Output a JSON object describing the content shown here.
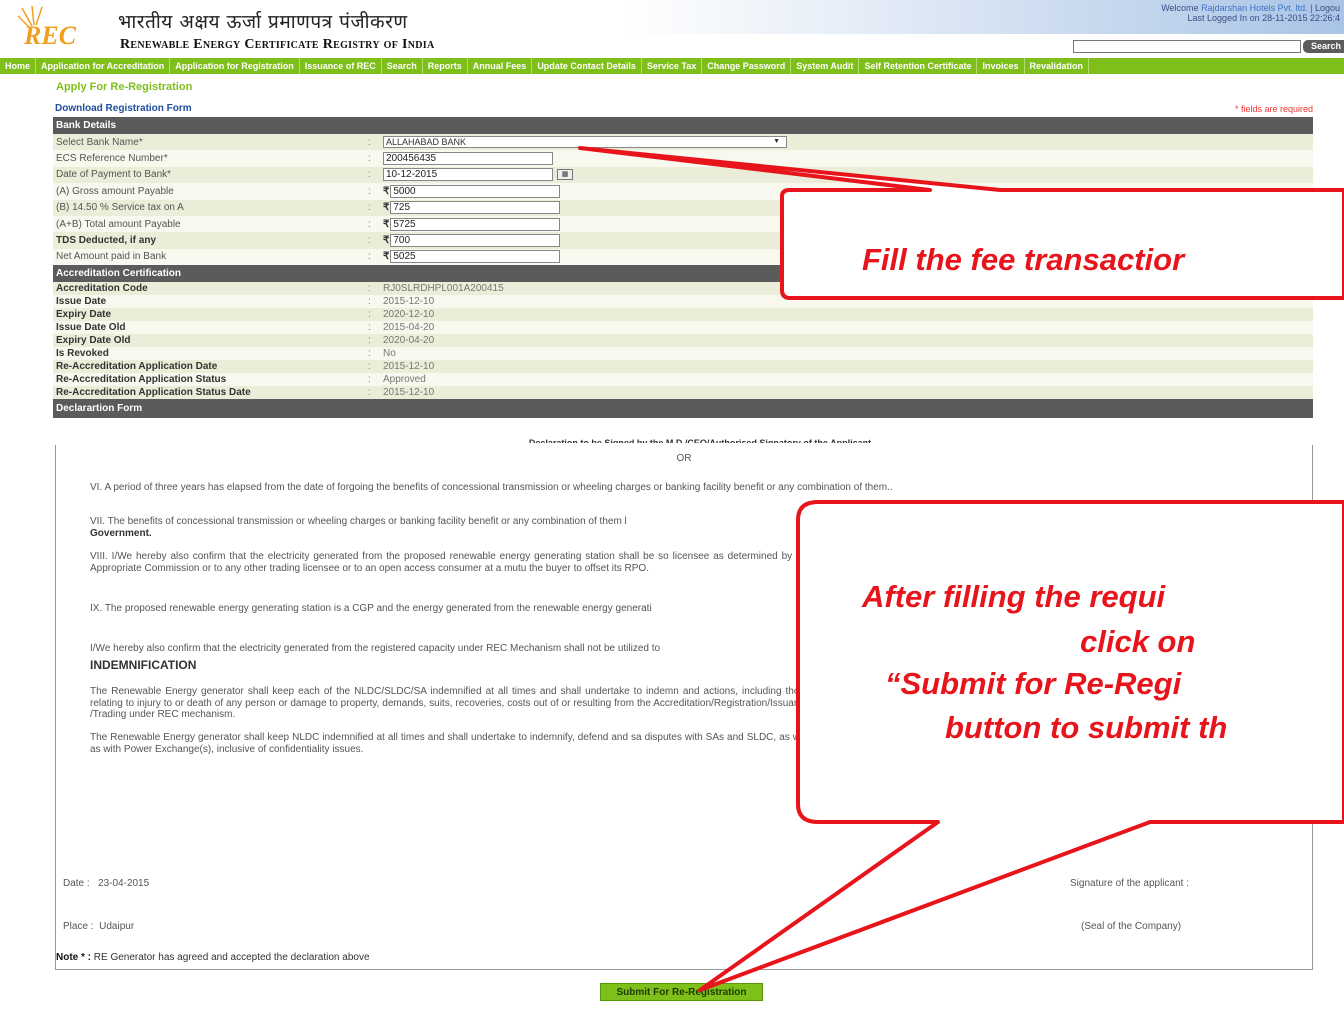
{
  "header": {
    "title_hindi": "भारतीय अक्षय ऊर्जा प्रमाणपत्र पंजीकरण",
    "title_english": "Renewable Energy Certificate Registry of India",
    "logo_text": "REC",
    "welcome_prefix": "Welcome ",
    "welcome_user": "Rajdarshan Hotels Pvt. ltd.",
    "logout": " | Logou",
    "last_logged": "Last Logged In on 28-11-2015 22:26:4",
    "search_label": "Search"
  },
  "nav": [
    "Home",
    "Application for Accreditation",
    "Application for Registration",
    "Issuance of REC",
    "Search",
    "Reports",
    "Annual Fees",
    "Update Contact Details",
    "Service Tax",
    "Change Password",
    "System Audit",
    "Self Retention Certificate",
    "Invoices",
    "Revalidation"
  ],
  "page": {
    "heading": "Apply For Re-Registration",
    "download_link": "Download Registration Form",
    "required_note": "* fields are required"
  },
  "bank": {
    "section_title": "Bank Details",
    "rows": [
      {
        "label": "Select Bank Name*",
        "value": "ALLAHABAD BANK"
      },
      {
        "label": "ECS Reference Number*",
        "value": "200456435"
      },
      {
        "label": "Date of Payment to Bank*",
        "value": "10-12-2015"
      },
      {
        "label": "(A) Gross amount Payable",
        "value": "5000"
      },
      {
        "label": "(B) 14.50 % Service tax on A",
        "value": "725"
      },
      {
        "label": "(A+B) Total amount Payable",
        "value": "5725"
      },
      {
        "label": "TDS Deducted, if any",
        "value": "700"
      },
      {
        "label": "Net Amount paid in Bank",
        "value": "5025"
      }
    ],
    "rupee": "₹"
  },
  "accreditation": {
    "section_title": "Accreditation Certification",
    "rows": [
      {
        "label": "Accreditation Code",
        "value": "RJ0SLRDHPL001A200415"
      },
      {
        "label": "Issue Date",
        "value": "2015-12-10"
      },
      {
        "label": "Expiry Date",
        "value": "2020-12-10"
      },
      {
        "label": "Issue Date Old",
        "value": "2015-04-20"
      },
      {
        "label": "Expiry Date Old",
        "value": "2020-04-20"
      },
      {
        "label": "Is Revoked",
        "value": "No"
      },
      {
        "label": "Re-Accreditation Application Date",
        "value": "2015-12-10"
      },
      {
        "label": "Re-Accreditation Application Status",
        "value": "Approved"
      },
      {
        "label": "Re-Accreditation Application Status Date",
        "value": "2015-12-10"
      }
    ]
  },
  "declaration": {
    "section_title": "Declarartion Form",
    "signed_by": "Declaration to be Signed by the M.D./CEO/Authorised Signatory of the Applicant",
    "or": "OR",
    "p6": "VI.  A period of three years has elapsed from the date of forgoing the benefits of concessional transmission or wheeling charges or banking facility benefit or any combination of them..",
    "p7_a": "VII.   The benefits of concessional transmission or wheeling charges or banking facility benefit or any combination of them l",
    "p7_b": "Government.",
    "p8": "VIII.  I/We hereby also confirm that the electricity generated from the proposed renewable energy generating station shall be so licensee as determined by the Appropriate Commission or to any other trading licensee or to an open access consumer at a mutu the buyer to offset its RPO.",
    "p9": "IX.  The proposed renewable energy generating station is a CGP and the energy generated from the renewable energy generati",
    "p10": "I/We hereby also confirm that the electricity generated from the registered capacity under REC Mechanism shall not be utilized to",
    "indemnification_title": "INDEMNIFICATION",
    "p11": "The Renewable Energy generator shall keep each of the NLDC/SLDC/SA indemnified at all times and shall undertake to indemn and actions, including those relating to injury to or death of any person or damage to property, demands, suits, recoveries, costs out of or resulting from the Accreditation/Registration/Issuance /Trading under REC mechanism.",
    "p12": "The Renewable Energy generator shall keep NLDC indemnified at all times and shall undertake to indemnify, defend and sa disputes with SAs and SLDC, as well as with Power Exchange(s), inclusive of confidentiality issues.",
    "date_label": "Date :",
    "date_value": "23-04-2015",
    "place_label": "Place :",
    "place_value": "Udaipur",
    "signature": "Signature of the applicant :",
    "seal": "(Seal of the Company)",
    "note_label": "Note * :",
    "note_text": " RE Generator has agreed and accepted the declaration above"
  },
  "submit_label": "Submit For Re-Registration",
  "callouts": {
    "top": "Fill the fee transactior",
    "bottom_l1": "After filling the requi",
    "bottom_l2": "click on",
    "bottom_l3": "“Submit for Re-Regi",
    "bottom_l4": "button to submit th"
  },
  "colors": {
    "nav_green": "#7fbf1a",
    "section_gray": "#5b5b5b",
    "callout_red": "#e8141c"
  }
}
